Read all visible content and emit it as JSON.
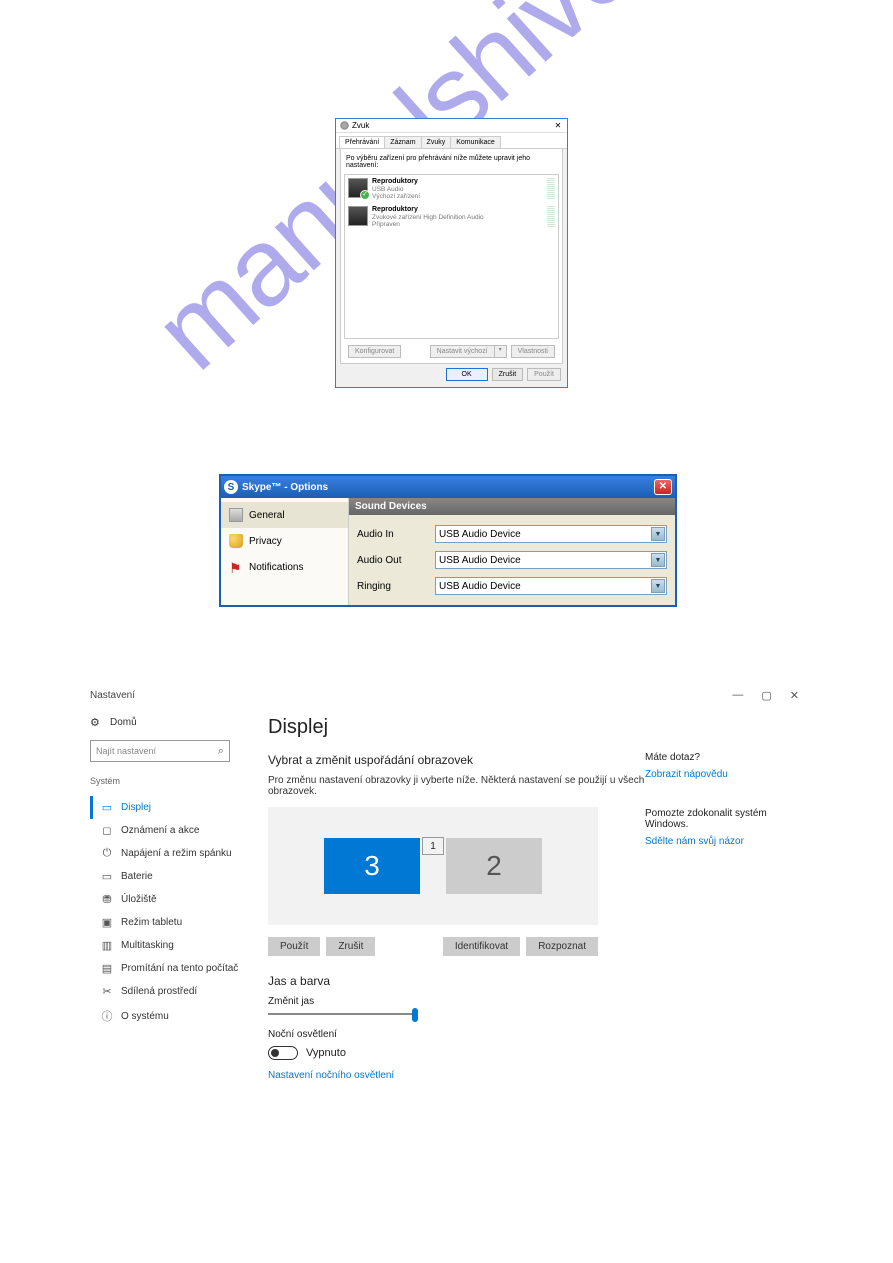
{
  "watermark": "manualshive.com",
  "zvuk": {
    "title": "Zvuk",
    "tabs": [
      "Přehrávání",
      "Záznam",
      "Zvuky",
      "Komunikace"
    ],
    "info": "Po výběru zařízení pro přehrávání níže můžete upravit jeho nastavení:",
    "dev1": {
      "name": "Reproduktory",
      "desc": "USB Audio",
      "status": "Výchozí zařízení"
    },
    "dev2": {
      "name": "Reproduktory",
      "desc": "Zvukové zařízení High Definition Audio",
      "status": "Připraven"
    },
    "btn_konfig": "Konfigurovat",
    "btn_default": "Nastavit výchozí",
    "btn_props": "Vlastnosti",
    "btn_ok": "OK",
    "btn_cancel": "Zrušit",
    "btn_apply": "Použít"
  },
  "skype": {
    "title": "Skype™ - Options",
    "side": {
      "general": "General",
      "privacy": "Privacy",
      "notifications": "Notifications"
    },
    "header": "Sound Devices",
    "rows": {
      "in": {
        "label": "Audio In",
        "value": "USB Audio Device"
      },
      "out": {
        "label": "Audio Out",
        "value": "USB Audio Device"
      },
      "ring": {
        "label": "Ringing",
        "value": "USB Audio Device"
      }
    }
  },
  "settings": {
    "app": "Nastavení",
    "home": "Domů",
    "search_placeholder": "Najít nastavení",
    "category": "Systém",
    "nav": {
      "displej": "Displej",
      "oznameni": "Oznámení a akce",
      "napajeni": "Napájení a režim spánku",
      "baterie": "Baterie",
      "uloziste": "Úložiště",
      "tablet": "Režim tabletu",
      "multitasking": "Multitasking",
      "promitani": "Promítání na tento počítač",
      "sdilena": "Sdílená prostředí",
      "osystemu": "O systému"
    },
    "h1": "Displej",
    "h2": "Vybrat a změnit uspořádání obrazovek",
    "desc": "Pro změnu nastavení obrazovky ji vyberte níže. Některá nastavení se použijí u všech obrazovek.",
    "monitors": {
      "m3": "3",
      "m1": "1",
      "m2": "2"
    },
    "btn_apply": "Použít",
    "btn_cancel": "Zrušit",
    "btn_identify": "Identifikovat",
    "btn_detect": "Rozpoznat",
    "jas_h": "Jas a barva",
    "jas_label": "Změnit jas",
    "night_label": "Noční osvětlení",
    "toggle_state": "Vypnuto",
    "night_link": "Nastavení nočního osvětlení",
    "right": {
      "q": "Máte dotaz?",
      "help": "Zobrazit nápovědu",
      "improve": "Pomozte zdokonalit systém Windows.",
      "feedback": "Sdělte nám svůj názor"
    }
  }
}
